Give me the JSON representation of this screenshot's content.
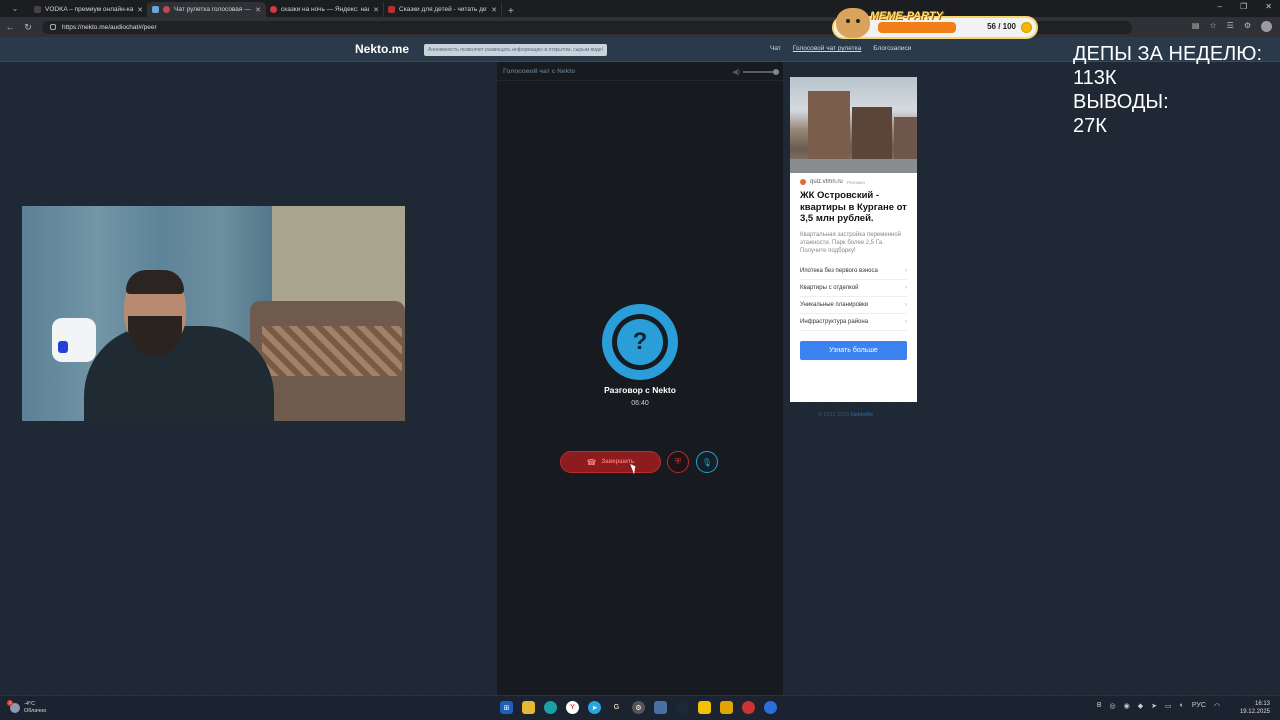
{
  "browser": {
    "tabs": [
      {
        "title": "VODKA – премиум онлайн-кази",
        "color": "#444"
      },
      {
        "title": "Чат рулетка голосовая — N",
        "color": "#6aa7d8"
      },
      {
        "title": "сказки на ночь — Яндекс: нашл",
        "color": "#d23b3b"
      },
      {
        "title": "Сказки для детей - читать детск",
        "color": "#b43232"
      }
    ],
    "url": "https://nekto.me/audiochat#/peer"
  },
  "site": {
    "logo": "Nekto.me",
    "notice": "Анонимность позволяет размещать информацию в открытом, сырым виде!",
    "nav": [
      "Чат",
      "Голосовой чат рулетка",
      "Блогозаписи"
    ]
  },
  "chat": {
    "header": "Голосовой чат с Nekto",
    "avatar_glyph": "?",
    "peer_name": "Разговор с Nekto",
    "timer": "06:40",
    "end_label": "Завершить"
  },
  "ad": {
    "source": "quiz.vtmn.ru",
    "tag": "Реклама",
    "title": "ЖК Островский - квартиры в Кургане от 3,5 млн рублей.",
    "desc": "Квартальная застройка переменной этажности. Парк более 2,5 Га. Получите подборку!",
    "links": [
      "Ипотека без первого взноса",
      "Квартиры с отделкой",
      "Уникальные планировки",
      "Инфраструктура района"
    ],
    "cta": "Узнать больше",
    "copyright": "© 2011-2025",
    "copyright_brand": "NektoMe"
  },
  "overlay": {
    "meme_title": "MEME-PARTY",
    "meme_count": "56 / 100",
    "meme_progress": 0.56,
    "stats": [
      "ДЕПЫ ЗА НЕДЕЛЮ:",
      "113К",
      "ВЫВОДЫ:",
      "27К"
    ]
  },
  "taskbar": {
    "temp": "-4°C",
    "weather": "Облачно",
    "lang": "РУС",
    "time": "16:13",
    "date": "19.12.2025"
  }
}
